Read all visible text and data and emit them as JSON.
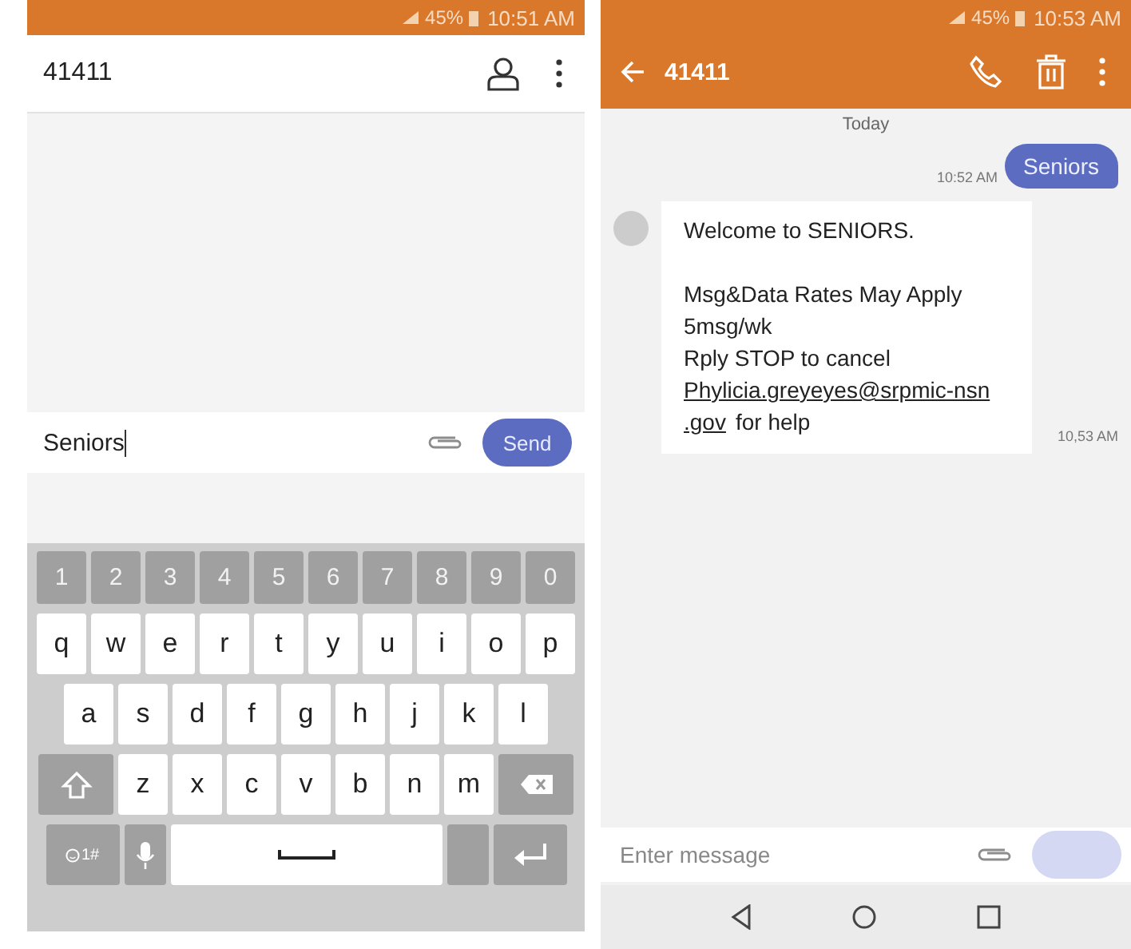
{
  "left_screen": {
    "status_bar": {
      "battery": "45%",
      "time": "10:51 AM"
    },
    "header": {
      "title": "41411"
    },
    "composer": {
      "value": "Seniors",
      "send": {
        "label": "Send",
        "disabled": false
      }
    },
    "keyboard": {
      "rows": [
        [
          {
            "kind": "number",
            "label": "1"
          },
          {
            "kind": "number",
            "label": "2"
          },
          {
            "kind": "number",
            "label": "3"
          },
          {
            "kind": "number",
            "label": "4"
          },
          {
            "kind": "number",
            "label": "5"
          },
          {
            "kind": "number",
            "label": "6"
          },
          {
            "kind": "number",
            "label": "7"
          },
          {
            "kind": "number",
            "label": "8"
          },
          {
            "kind": "number",
            "label": "9"
          },
          {
            "kind": "number",
            "label": "0"
          }
        ],
        [
          {
            "kind": "char",
            "label": "q"
          },
          {
            "kind": "char",
            "label": "w"
          },
          {
            "kind": "char",
            "label": "e"
          },
          {
            "kind": "char",
            "label": "r"
          },
          {
            "kind": "char",
            "label": "t"
          },
          {
            "kind": "char",
            "label": "y"
          },
          {
            "kind": "char",
            "label": "u"
          },
          {
            "kind": "char",
            "label": "i"
          },
          {
            "kind": "char",
            "label": "o"
          },
          {
            "kind": "char",
            "label": "p"
          }
        ],
        [
          {
            "kind": "char",
            "label": "a"
          },
          {
            "kind": "char",
            "label": "s"
          },
          {
            "kind": "char",
            "label": "d"
          },
          {
            "kind": "char",
            "label": "f"
          },
          {
            "kind": "char",
            "label": "g"
          },
          {
            "kind": "char",
            "label": "h"
          },
          {
            "kind": "char",
            "label": "j"
          },
          {
            "kind": "char",
            "label": "k"
          },
          {
            "kind": "char",
            "label": "l"
          }
        ],
        [
          {
            "kind": "shift"
          },
          {
            "kind": "char",
            "label": "z"
          },
          {
            "kind": "char",
            "label": "x"
          },
          {
            "kind": "char",
            "label": "c"
          },
          {
            "kind": "char",
            "label": "v"
          },
          {
            "kind": "char",
            "label": "b"
          },
          {
            "kind": "char",
            "label": "n"
          },
          {
            "kind": "char",
            "label": "m"
          },
          {
            "kind": "backspace"
          }
        ],
        [
          {
            "kind": "symbols",
            "label": "1#"
          },
          {
            "kind": "mic"
          },
          {
            "kind": "space"
          },
          {
            "kind": "blank"
          },
          {
            "kind": "enter"
          }
        ]
      ]
    }
  },
  "right_screen": {
    "status_bar": {
      "battery": "45%",
      "time": "10:53 AM"
    },
    "header": {
      "title": "41411"
    },
    "date_divider": "Today",
    "messages": [
      {
        "kind": "sent",
        "text": "Seniors",
        "time": "10:52 AM"
      },
      {
        "kind": "received",
        "lines": [
          "Welcome to SENIORS.",
          "Msg&Data Rates May Apply\n5msg/wk\nRply STOP to cancel"
        ],
        "link_lines": [
          "Phylicia.greyeyes@srpmic-nsn",
          ".gov"
        ],
        "after_link": "for help",
        "time": "10,53 AM"
      }
    ],
    "composer": {
      "placeholder": "Enter message",
      "send": {
        "disabled": true
      }
    }
  }
}
